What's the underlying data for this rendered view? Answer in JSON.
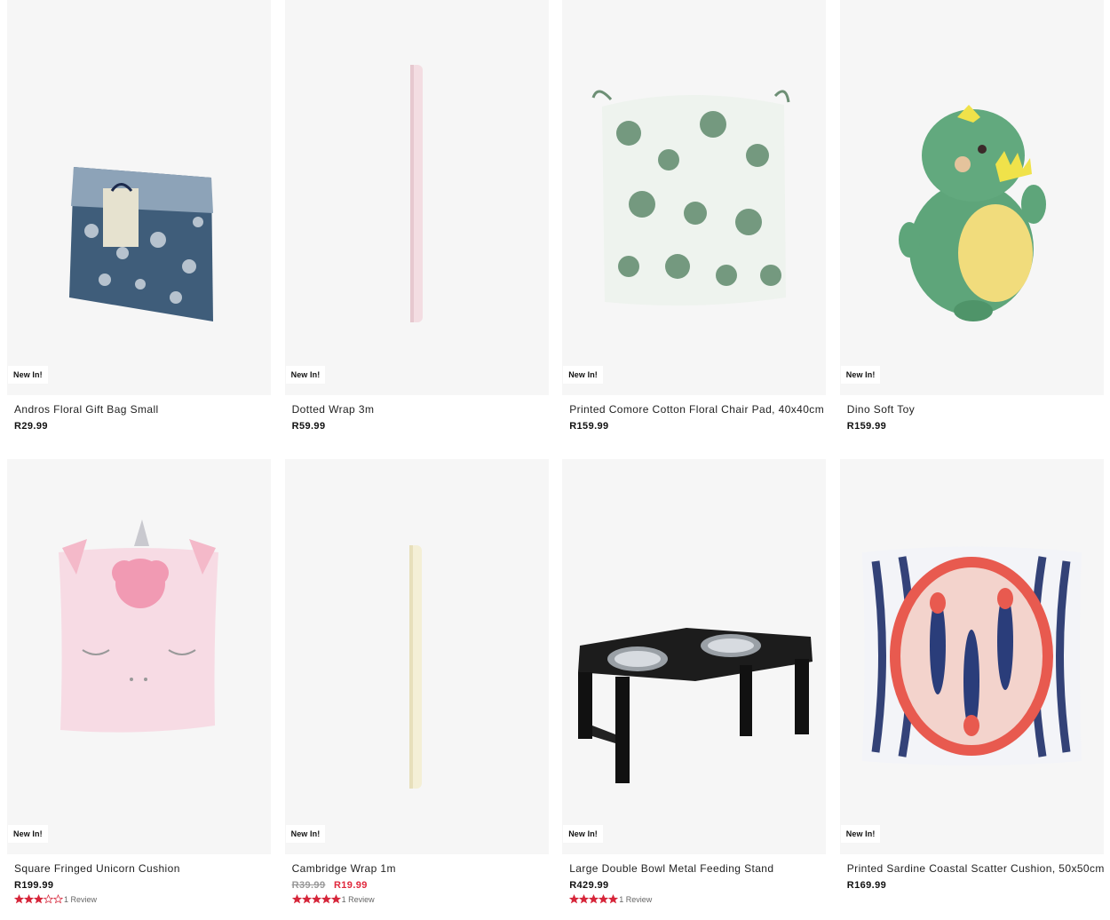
{
  "products": [
    {
      "title": "Andros Floral Gift Bag Small",
      "badge": "New In!",
      "price": "R29.99",
      "image_icon": "gift-bag-image"
    },
    {
      "title": "Dotted Wrap 3m",
      "badge": "New In!",
      "price": "R59.99",
      "image_icon": "wrapping-roll-image"
    },
    {
      "title": "Printed Comore Cotton Floral Chair Pad, 40x40cm",
      "badge": "New In!",
      "price": "R159.99",
      "image_icon": "chair-pad-image"
    },
    {
      "title": "Dino Soft Toy",
      "badge": "New In!",
      "price": "R159.99",
      "image_icon": "dino-toy-image"
    },
    {
      "title": "Square Fringed Unicorn Cushion",
      "badge": "New In!",
      "price": "R199.99",
      "rating": 3,
      "reviews": "1 Review",
      "image_icon": "unicorn-cushion-image"
    },
    {
      "title": "Cambridge Wrap 1m",
      "badge": "New In!",
      "price_old": "R39.99",
      "price_sale": "R19.99",
      "rating": 5,
      "reviews": "1 Review",
      "image_icon": "wrapping-roll-image"
    },
    {
      "title": "Large Double Bowl Metal Feeding Stand",
      "badge": "New In!",
      "price": "R429.99",
      "rating": 5,
      "reviews": "1 Review",
      "image_icon": "feeding-stand-image"
    },
    {
      "title": "Printed Sardine Coastal Scatter Cushion, 50x50cm",
      "badge": "New In!",
      "price": "R169.99",
      "image_icon": "sardine-cushion-image"
    }
  ],
  "colors": {
    "card_bg": "#f6f6f6",
    "star": "#d6263a",
    "sale_price": "#e0283c"
  }
}
